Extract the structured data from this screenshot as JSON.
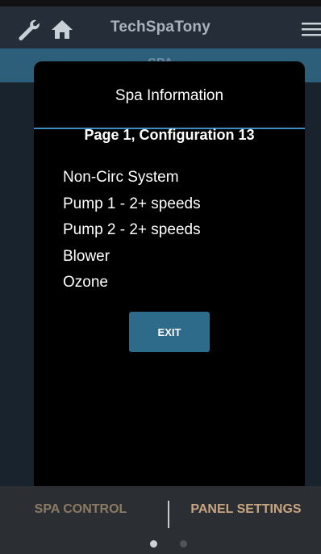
{
  "app": {
    "title": "TechSpaTony",
    "section_label": "SPA"
  },
  "icons": {
    "wrench": "wrench-icon",
    "home": "home-icon",
    "menu": "hamburger-menu-icon"
  },
  "modal": {
    "title": "Spa Information",
    "subtitle": "Page 1, Configuration 13",
    "items": [
      "Non-Circ System",
      "Pump 1 - 2+ speeds",
      "Pump 2 - 2+ speeds",
      "Blower",
      "Ozone"
    ],
    "exit_label": "EXIT"
  },
  "tabs": {
    "spa_control": "SPA CONTROL",
    "panel_settings": "PANEL SETTINGS"
  },
  "pager": {
    "current_page": 1,
    "total_pages": 2
  },
  "colors": {
    "accent_blue": "#2e6a89",
    "tab_text": "#c8a57f"
  }
}
